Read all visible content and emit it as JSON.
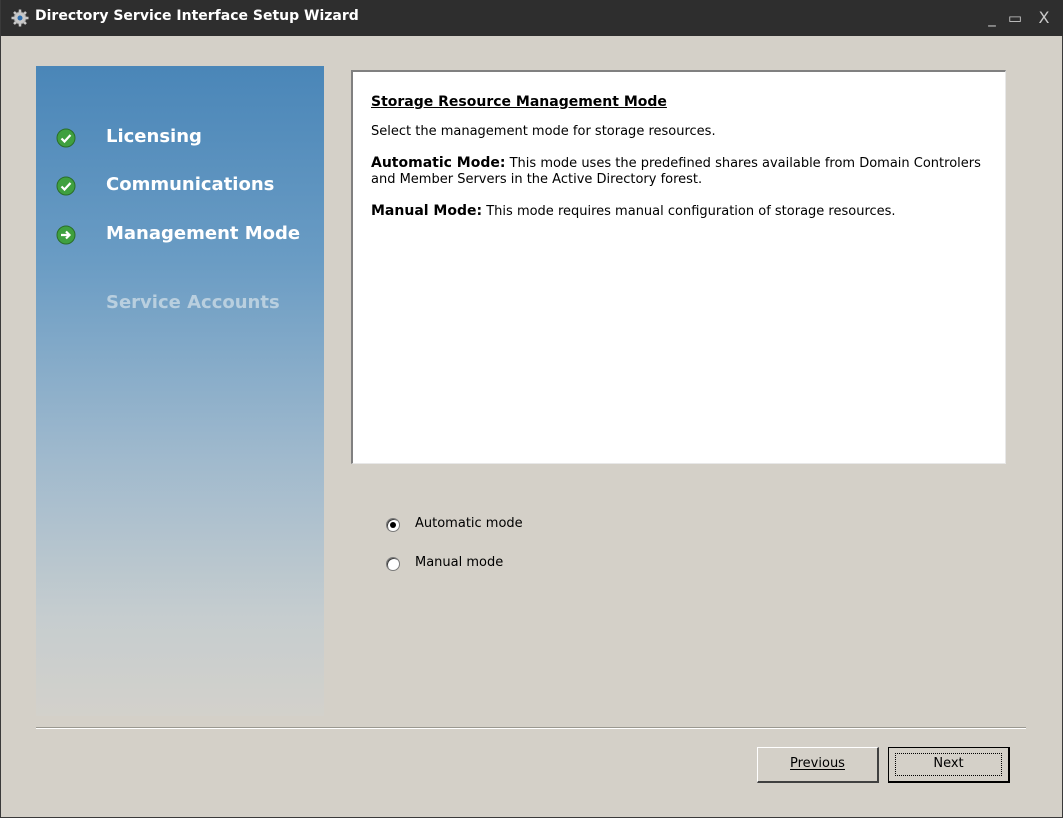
{
  "window": {
    "title": "Directory Service Interface Setup Wizard",
    "controls": {
      "minimize": "_",
      "maximize": "▭",
      "close": "X"
    }
  },
  "sidebar": {
    "steps": [
      {
        "label": "Licensing",
        "state": "completed",
        "icon": "check-circle-icon"
      },
      {
        "label": "Communications",
        "state": "completed",
        "icon": "check-circle-icon"
      },
      {
        "label": "Management Mode",
        "state": "current",
        "icon": "arrow-circle-icon"
      },
      {
        "label": "Service Accounts",
        "state": "pending",
        "icon": ""
      }
    ]
  },
  "info": {
    "heading": "Storage Resource Management Mode",
    "intro": "Select the management mode for storage resources.",
    "auto_title": "Automatic Mode:",
    "auto_text": " This mode uses the predefined shares available from Domain Controlers and Member Servers in the Active Directory forest.",
    "manual_title": "Manual Mode:",
    "manual_text": " This mode requires manual configuration of storage resources."
  },
  "options": {
    "automatic_label": "Automatic mode",
    "manual_label": "Manual mode",
    "selected": "automatic"
  },
  "buttons": {
    "previous": "Previous",
    "next": "Next"
  },
  "colors": {
    "titlebar": "#2e2e2e",
    "sidebar_top": "#4a86b8",
    "step_icon_green": "#3a9a3a",
    "face": "#d4d0c8"
  }
}
